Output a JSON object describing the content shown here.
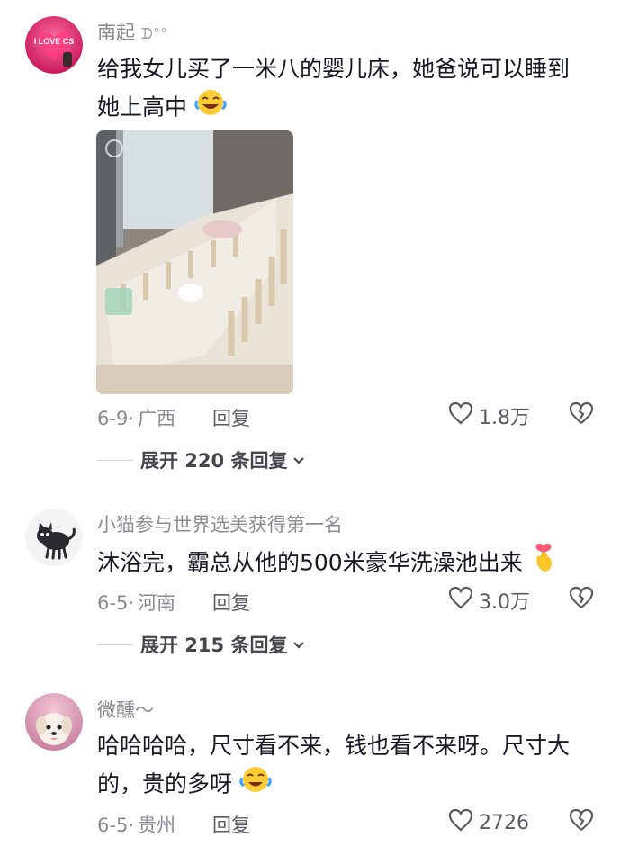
{
  "comments": [
    {
      "username": "南起",
      "username_badge": "ᗪ°°",
      "avatar_text": "I LOVE CS",
      "text_lines": [
        "给我女儿买了一米八的婴儿床，她爸说可以睡到",
        "她上高中"
      ],
      "emoji": "laughing-crying-emoji",
      "date": "6-9",
      "location": "广西",
      "reply_label": "回复",
      "likes": "1.8万",
      "expand_label": "展开 220 条回复"
    },
    {
      "username": "小猫参与世界选美获得第一名",
      "text_lines": [
        "沐浴完，霸总从他的500米豪华洗澡池出来"
      ],
      "emoji": "finger-heart-emoji",
      "date": "6-5",
      "location": "河南",
      "reply_label": "回复",
      "likes": "3.0万",
      "expand_label": "展开 215 条回复"
    },
    {
      "username": "微醺～",
      "text_lines": [
        "哈哈哈哈，尺寸看不来，钱也看不来呀。尺寸大",
        "的，贵的多呀"
      ],
      "emoji": "crying-laughing-emoji",
      "date": "6-5",
      "location": "贵州",
      "reply_label": "回复",
      "likes": "2726"
    }
  ],
  "meta_separator": "·",
  "colors": {
    "text": "#161823",
    "muted": "#8a8b91",
    "accent_pink": "#e8345f"
  }
}
